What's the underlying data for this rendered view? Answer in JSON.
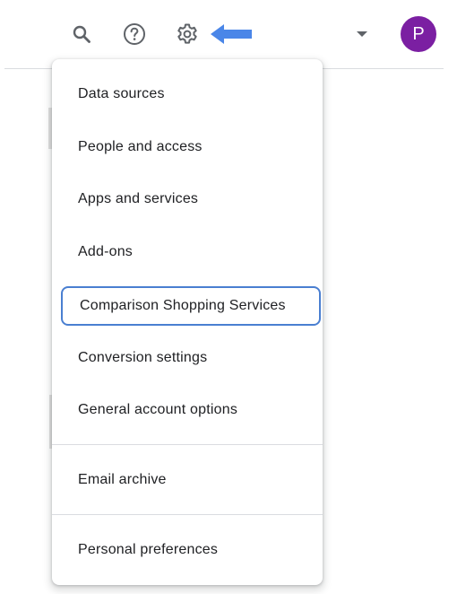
{
  "header": {
    "icons": [
      "search-icon",
      "help-icon",
      "settings-icon",
      "arrow-left-icon",
      "caret-down-icon"
    ],
    "avatar_initial": "P",
    "avatar_color": "#7b1fa2",
    "arrow_color": "#4a86e8"
  },
  "settings_menu": {
    "items": [
      {
        "label": "Data sources"
      },
      {
        "label": "People and access"
      },
      {
        "label": "Apps and services"
      },
      {
        "label": "Add-ons"
      },
      {
        "label": "Comparison Shopping Services",
        "focused": true
      },
      {
        "label": "Conversion settings"
      },
      {
        "label": "General account options"
      },
      {
        "label": "Email archive"
      },
      {
        "label": "Personal preferences"
      }
    ]
  },
  "colors": {
    "focus_ring": "#4a7fd1",
    "divider": "#dadce0",
    "text": "#202124"
  }
}
